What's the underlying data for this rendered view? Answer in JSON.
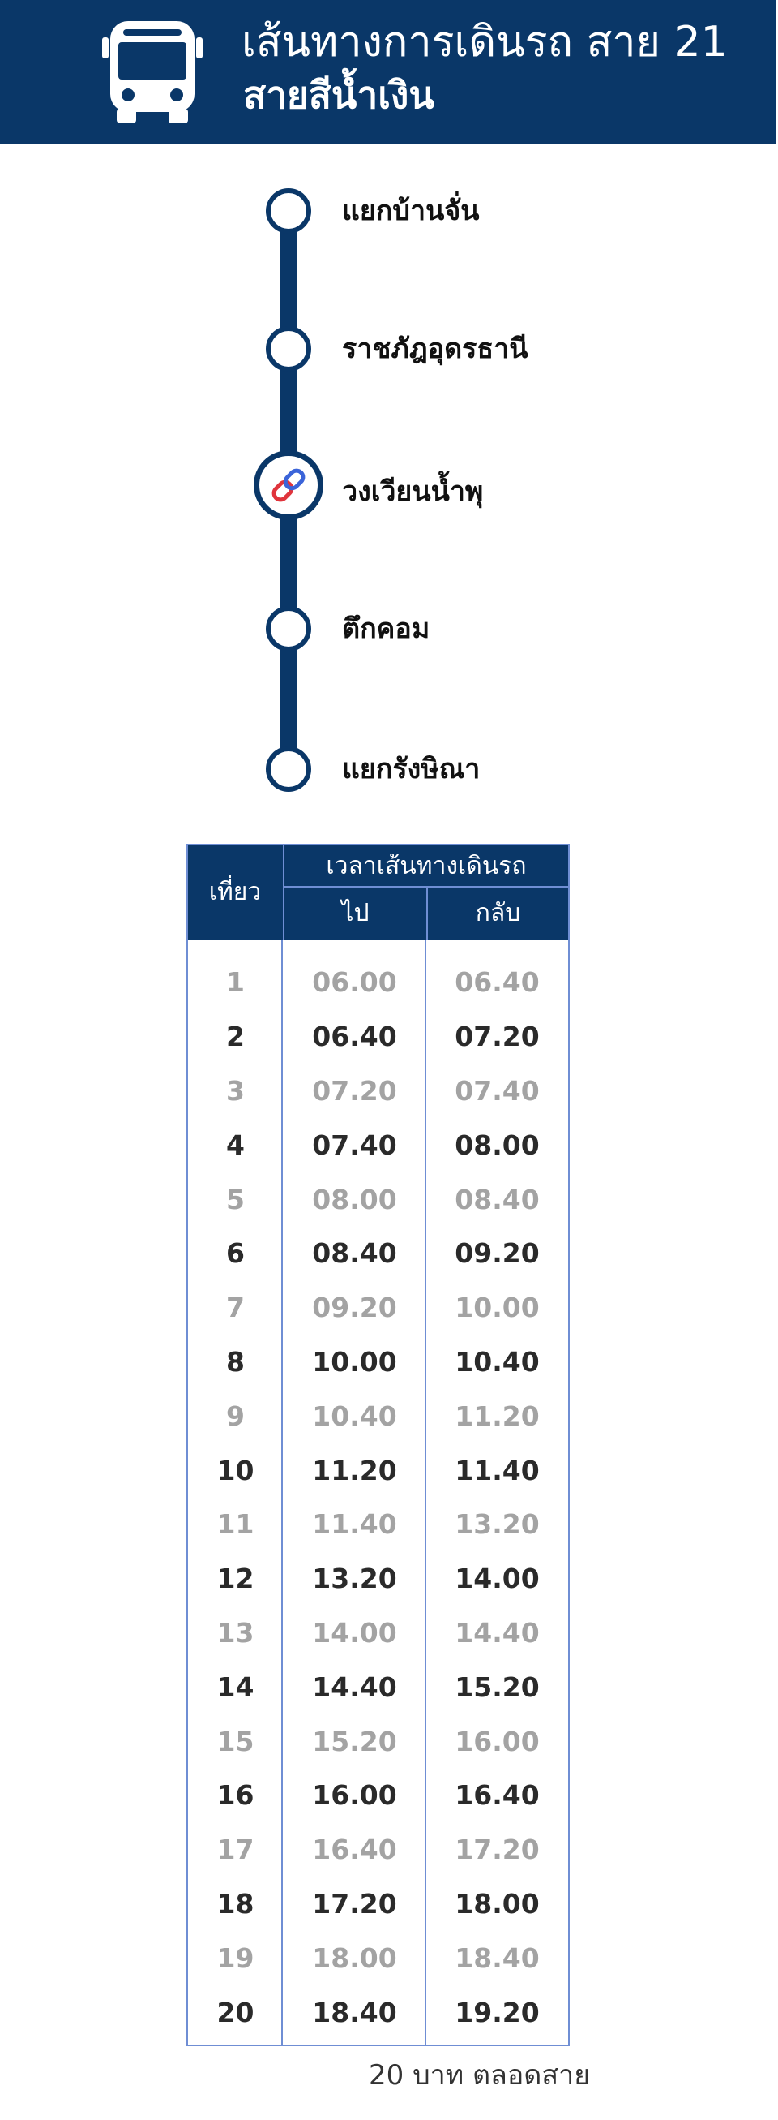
{
  "header": {
    "title": "เส้นทางการเดินรถ สาย 21",
    "subtitle": "สายสีน้ำเงิน",
    "icon": "bus-icon",
    "color": "#0a3768"
  },
  "route": {
    "stops": [
      {
        "name": "แยกบ้านจั่น"
      },
      {
        "name": "ราชภัฎอุดรธานี"
      },
      {
        "name": "วงเวียนน้ำพุ",
        "icon": "link-icon"
      },
      {
        "name": "ตึกคอม"
      },
      {
        "name": "แยกรังษิณา"
      }
    ]
  },
  "schedule": {
    "col_trip": "เที่ยว",
    "col_group": "เวลาเส้นทางเดินรถ",
    "col_go": "ไป",
    "col_back": "กลับ",
    "rows": [
      {
        "trip": "1",
        "go": "06.00",
        "back": "06.40"
      },
      {
        "trip": "2",
        "go": "06.40",
        "back": "07.20"
      },
      {
        "trip": "3",
        "go": "07.20",
        "back": "07.40"
      },
      {
        "trip": "4",
        "go": "07.40",
        "back": "08.00"
      },
      {
        "trip": "5",
        "go": "08.00",
        "back": "08.40"
      },
      {
        "trip": "6",
        "go": "08.40",
        "back": "09.20"
      },
      {
        "trip": "7",
        "go": "09.20",
        "back": "10.00"
      },
      {
        "trip": "8",
        "go": "10.00",
        "back": "10.40"
      },
      {
        "trip": "9",
        "go": "10.40",
        "back": "11.20"
      },
      {
        "trip": "10",
        "go": "11.20",
        "back": "11.40"
      },
      {
        "trip": "11",
        "go": "11.40",
        "back": "13.20"
      },
      {
        "trip": "12",
        "go": "13.20",
        "back": "14.00"
      },
      {
        "trip": "13",
        "go": "14.00",
        "back": "14.40"
      },
      {
        "trip": "14",
        "go": "14.40",
        "back": "15.20"
      },
      {
        "trip": "15",
        "go": "15.20",
        "back": "16.00"
      },
      {
        "trip": "16",
        "go": "16.00",
        "back": "16.40"
      },
      {
        "trip": "17",
        "go": "16.40",
        "back": "17.20"
      },
      {
        "trip": "18",
        "go": "17.20",
        "back": "18.00"
      },
      {
        "trip": "19",
        "go": "18.00",
        "back": "18.40"
      },
      {
        "trip": "20",
        "go": "18.40",
        "back": "19.20"
      }
    ]
  },
  "fare": "20 บาท ตลอดสาย"
}
